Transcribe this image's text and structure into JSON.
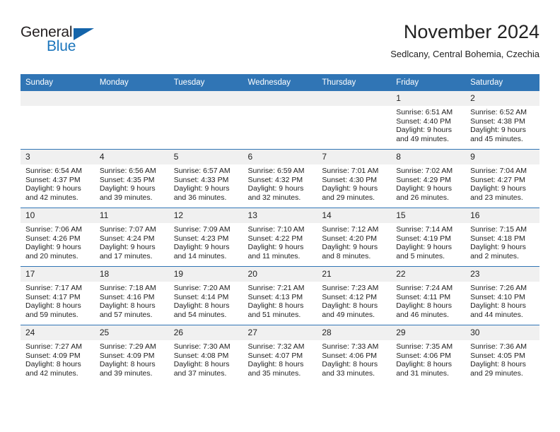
{
  "brand": {
    "name_part1": "General",
    "name_part2": "Blue",
    "accent_color": "#1b75bc",
    "triangle_color": "#1464aa"
  },
  "header": {
    "title": "November 2024",
    "subtitle": "Sedlcany, Central Bohemia, Czechia"
  },
  "calendar": {
    "header_background": "#3075b5",
    "daynum_background": "#f0f0f0",
    "weekday_headers": [
      "Sunday",
      "Monday",
      "Tuesday",
      "Wednesday",
      "Thursday",
      "Friday",
      "Saturday"
    ],
    "weeks": [
      [
        {
          "day": "",
          "sunrise": "",
          "sunset": "",
          "daylight": ""
        },
        {
          "day": "",
          "sunrise": "",
          "sunset": "",
          "daylight": ""
        },
        {
          "day": "",
          "sunrise": "",
          "sunset": "",
          "daylight": ""
        },
        {
          "day": "",
          "sunrise": "",
          "sunset": "",
          "daylight": ""
        },
        {
          "day": "",
          "sunrise": "",
          "sunset": "",
          "daylight": ""
        },
        {
          "day": "1",
          "sunrise": "Sunrise: 6:51 AM",
          "sunset": "Sunset: 4:40 PM",
          "daylight": "Daylight: 9 hours and 49 minutes."
        },
        {
          "day": "2",
          "sunrise": "Sunrise: 6:52 AM",
          "sunset": "Sunset: 4:38 PM",
          "daylight": "Daylight: 9 hours and 45 minutes."
        }
      ],
      [
        {
          "day": "3",
          "sunrise": "Sunrise: 6:54 AM",
          "sunset": "Sunset: 4:37 PM",
          "daylight": "Daylight: 9 hours and 42 minutes."
        },
        {
          "day": "4",
          "sunrise": "Sunrise: 6:56 AM",
          "sunset": "Sunset: 4:35 PM",
          "daylight": "Daylight: 9 hours and 39 minutes."
        },
        {
          "day": "5",
          "sunrise": "Sunrise: 6:57 AM",
          "sunset": "Sunset: 4:33 PM",
          "daylight": "Daylight: 9 hours and 36 minutes."
        },
        {
          "day": "6",
          "sunrise": "Sunrise: 6:59 AM",
          "sunset": "Sunset: 4:32 PM",
          "daylight": "Daylight: 9 hours and 32 minutes."
        },
        {
          "day": "7",
          "sunrise": "Sunrise: 7:01 AM",
          "sunset": "Sunset: 4:30 PM",
          "daylight": "Daylight: 9 hours and 29 minutes."
        },
        {
          "day": "8",
          "sunrise": "Sunrise: 7:02 AM",
          "sunset": "Sunset: 4:29 PM",
          "daylight": "Daylight: 9 hours and 26 minutes."
        },
        {
          "day": "9",
          "sunrise": "Sunrise: 7:04 AM",
          "sunset": "Sunset: 4:27 PM",
          "daylight": "Daylight: 9 hours and 23 minutes."
        }
      ],
      [
        {
          "day": "10",
          "sunrise": "Sunrise: 7:06 AM",
          "sunset": "Sunset: 4:26 PM",
          "daylight": "Daylight: 9 hours and 20 minutes."
        },
        {
          "day": "11",
          "sunrise": "Sunrise: 7:07 AM",
          "sunset": "Sunset: 4:24 PM",
          "daylight": "Daylight: 9 hours and 17 minutes."
        },
        {
          "day": "12",
          "sunrise": "Sunrise: 7:09 AM",
          "sunset": "Sunset: 4:23 PM",
          "daylight": "Daylight: 9 hours and 14 minutes."
        },
        {
          "day": "13",
          "sunrise": "Sunrise: 7:10 AM",
          "sunset": "Sunset: 4:22 PM",
          "daylight": "Daylight: 9 hours and 11 minutes."
        },
        {
          "day": "14",
          "sunrise": "Sunrise: 7:12 AM",
          "sunset": "Sunset: 4:20 PM",
          "daylight": "Daylight: 9 hours and 8 minutes."
        },
        {
          "day": "15",
          "sunrise": "Sunrise: 7:14 AM",
          "sunset": "Sunset: 4:19 PM",
          "daylight": "Daylight: 9 hours and 5 minutes."
        },
        {
          "day": "16",
          "sunrise": "Sunrise: 7:15 AM",
          "sunset": "Sunset: 4:18 PM",
          "daylight": "Daylight: 9 hours and 2 minutes."
        }
      ],
      [
        {
          "day": "17",
          "sunrise": "Sunrise: 7:17 AM",
          "sunset": "Sunset: 4:17 PM",
          "daylight": "Daylight: 8 hours and 59 minutes."
        },
        {
          "day": "18",
          "sunrise": "Sunrise: 7:18 AM",
          "sunset": "Sunset: 4:16 PM",
          "daylight": "Daylight: 8 hours and 57 minutes."
        },
        {
          "day": "19",
          "sunrise": "Sunrise: 7:20 AM",
          "sunset": "Sunset: 4:14 PM",
          "daylight": "Daylight: 8 hours and 54 minutes."
        },
        {
          "day": "20",
          "sunrise": "Sunrise: 7:21 AM",
          "sunset": "Sunset: 4:13 PM",
          "daylight": "Daylight: 8 hours and 51 minutes."
        },
        {
          "day": "21",
          "sunrise": "Sunrise: 7:23 AM",
          "sunset": "Sunset: 4:12 PM",
          "daylight": "Daylight: 8 hours and 49 minutes."
        },
        {
          "day": "22",
          "sunrise": "Sunrise: 7:24 AM",
          "sunset": "Sunset: 4:11 PM",
          "daylight": "Daylight: 8 hours and 46 minutes."
        },
        {
          "day": "23",
          "sunrise": "Sunrise: 7:26 AM",
          "sunset": "Sunset: 4:10 PM",
          "daylight": "Daylight: 8 hours and 44 minutes."
        }
      ],
      [
        {
          "day": "24",
          "sunrise": "Sunrise: 7:27 AM",
          "sunset": "Sunset: 4:09 PM",
          "daylight": "Daylight: 8 hours and 42 minutes."
        },
        {
          "day": "25",
          "sunrise": "Sunrise: 7:29 AM",
          "sunset": "Sunset: 4:09 PM",
          "daylight": "Daylight: 8 hours and 39 minutes."
        },
        {
          "day": "26",
          "sunrise": "Sunrise: 7:30 AM",
          "sunset": "Sunset: 4:08 PM",
          "daylight": "Daylight: 8 hours and 37 minutes."
        },
        {
          "day": "27",
          "sunrise": "Sunrise: 7:32 AM",
          "sunset": "Sunset: 4:07 PM",
          "daylight": "Daylight: 8 hours and 35 minutes."
        },
        {
          "day": "28",
          "sunrise": "Sunrise: 7:33 AM",
          "sunset": "Sunset: 4:06 PM",
          "daylight": "Daylight: 8 hours and 33 minutes."
        },
        {
          "day": "29",
          "sunrise": "Sunrise: 7:35 AM",
          "sunset": "Sunset: 4:06 PM",
          "daylight": "Daylight: 8 hours and 31 minutes."
        },
        {
          "day": "30",
          "sunrise": "Sunrise: 7:36 AM",
          "sunset": "Sunset: 4:05 PM",
          "daylight": "Daylight: 8 hours and 29 minutes."
        }
      ]
    ]
  }
}
